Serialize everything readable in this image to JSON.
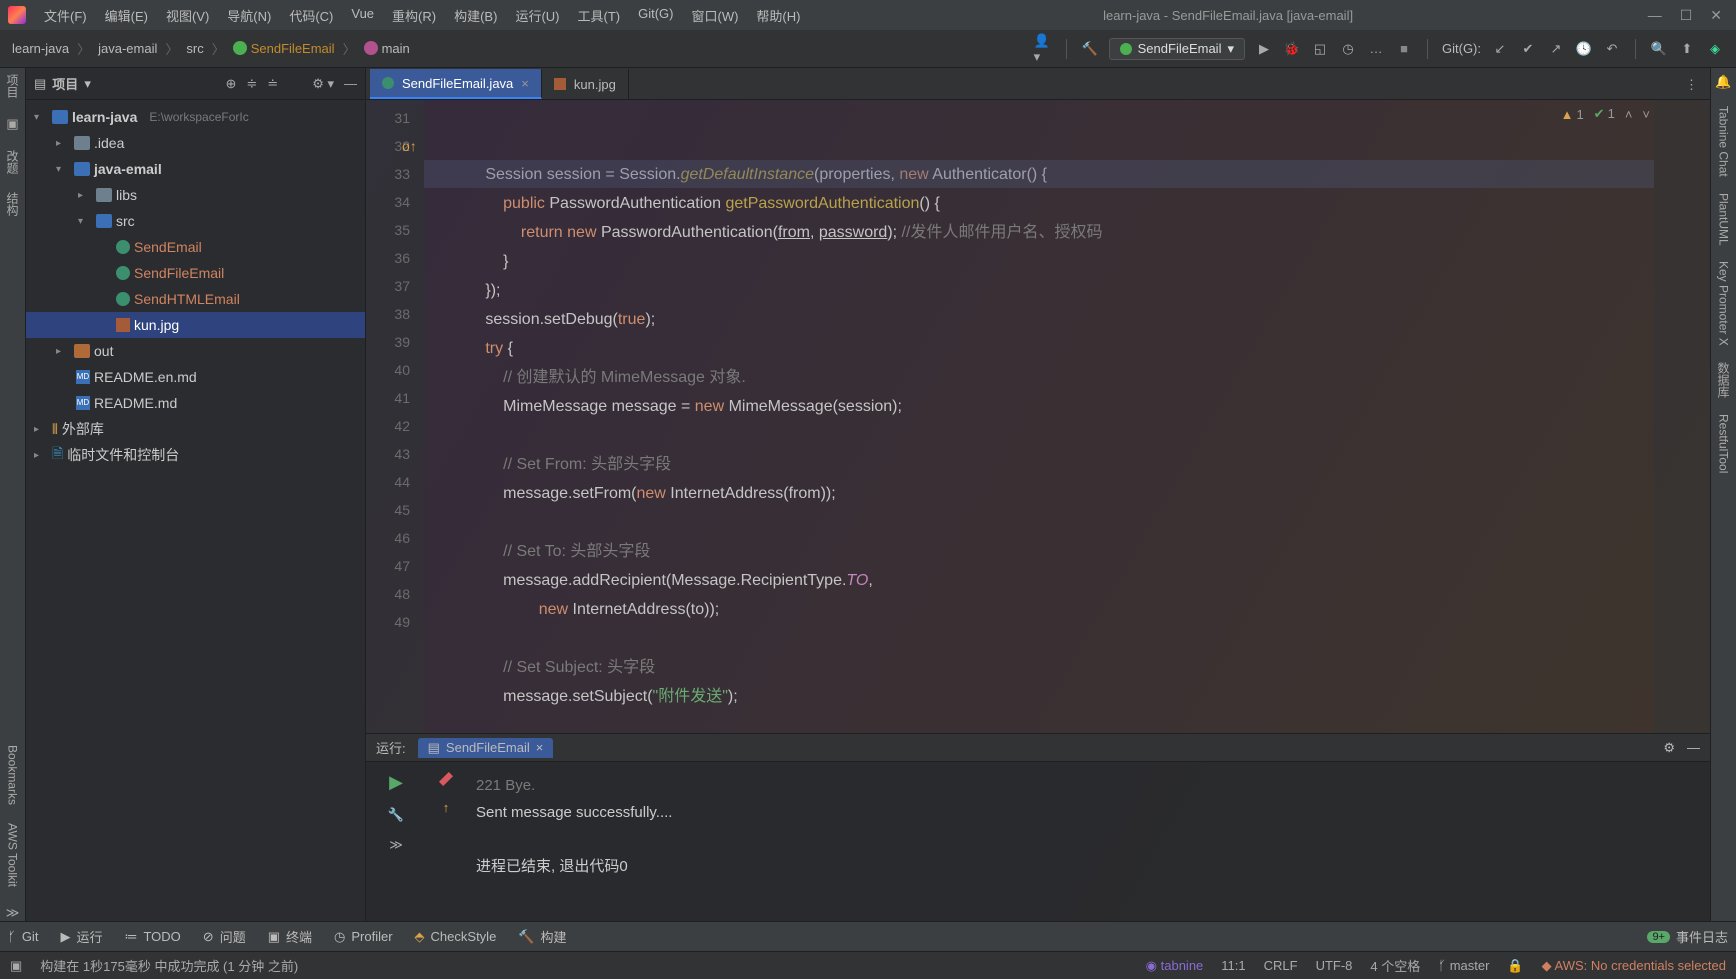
{
  "window_title": "learn-java - SendFileEmail.java [java-email]",
  "menus": [
    "文件(F)",
    "编辑(E)",
    "视图(V)",
    "导航(N)",
    "代码(C)",
    "Vue",
    "重构(R)",
    "构建(B)",
    "运行(U)",
    "工具(T)",
    "Git(G)",
    "窗口(W)",
    "帮助(H)"
  ],
  "crumbs": {
    "p1": "learn-java",
    "p2": "java-email",
    "p3": "src",
    "cls": "SendFileEmail",
    "meth": "main"
  },
  "run_config": "SendFileEmail",
  "git_label": "Git(G):",
  "project": {
    "title": "项目",
    "root": "learn-java",
    "root_path": "E:\\workspaceForIc",
    "idea": ".idea",
    "module": "java-email",
    "libs": "libs",
    "src": "src",
    "files": [
      "SendEmail",
      "SendFileEmail",
      "SendHTMLEmail"
    ],
    "img": "kun.jpg",
    "out": "out",
    "readme_en": "README.en.md",
    "readme": "README.md",
    "ext_lib": "外部库",
    "scratch": "临时文件和控制台"
  },
  "tabs": {
    "active": "SendFileEmail.java",
    "other": "kun.jpg"
  },
  "inspections": {
    "warn": "1",
    "ok": "1"
  },
  "gutter_lines": [
    "31",
    "32",
    "33",
    "34",
    "35",
    "36",
    "37",
    "38",
    "39",
    "40",
    "41",
    "42",
    "43",
    "44",
    "45",
    "46",
    "47",
    "48",
    "49"
  ],
  "code": {
    "l31": "            Session session = Session.getDefaultInstance(properties, new Authenticator() {",
    "l32": "                public PasswordAuthentication getPasswordAuthentication() {",
    "l33_a": "                    return new PasswordAuthentication(",
    "l33_from": "from",
    "l33_b": ", ",
    "l33_pw": "password",
    "l33_c": "); ",
    "l33_cm": "//发件人邮件用户名、授权码",
    "l34": "                }",
    "l35": "            });",
    "l36": "            session.setDebug(true);",
    "l37": "            try {",
    "l38": "                // 创建默认的 MimeMessage 对象.",
    "l39": "                MimeMessage message = new MimeMessage(session);",
    "l41": "                // Set From: 头部头字段",
    "l42": "                message.setFrom(new InternetAddress(from));",
    "l44": "                // Set To: 头部头字段",
    "l45": "                message.addRecipient(Message.RecipientType.TO,",
    "l46": "                        new InternetAddress(to));",
    "l48": "                // Set Subject: 头字段",
    "l49_a": "                message.setSubject(",
    "l49_str": "\"附件发送\"",
    "l49_b": ");"
  },
  "run": {
    "label": "运行:",
    "cfg": "SendFileEmail",
    "out0": "221 Bye.",
    "out1": "Sent message successfully....",
    "out2": "",
    "out3": "进程已结束, 退出代码0"
  },
  "bottom_tabs": {
    "git": "Git",
    "run": "运行",
    "todo": "TODO",
    "problems": "问题",
    "terminal": "终端",
    "profiler": "Profiler",
    "checkstyle": "CheckStyle",
    "build": "构建",
    "events": "事件日志"
  },
  "status": {
    "build": "构建在 1秒175毫秒 中成功完成 (1 分钟 之前)",
    "tabnine": "tabnine",
    "pos": "11:1",
    "eol": "CRLF",
    "enc": "UTF-8",
    "indent": "4 个空格",
    "branch": "master",
    "aws": "AWS: No credentials selected"
  },
  "right_stripe": [
    "Tabnine Chat",
    "PlantUML",
    "Key Promoter X",
    "数据库",
    "RestfulTool"
  ],
  "left_stripe": [
    "项目",
    "改题",
    "结构",
    "Bookmarks",
    "AWS Toolkit"
  ]
}
